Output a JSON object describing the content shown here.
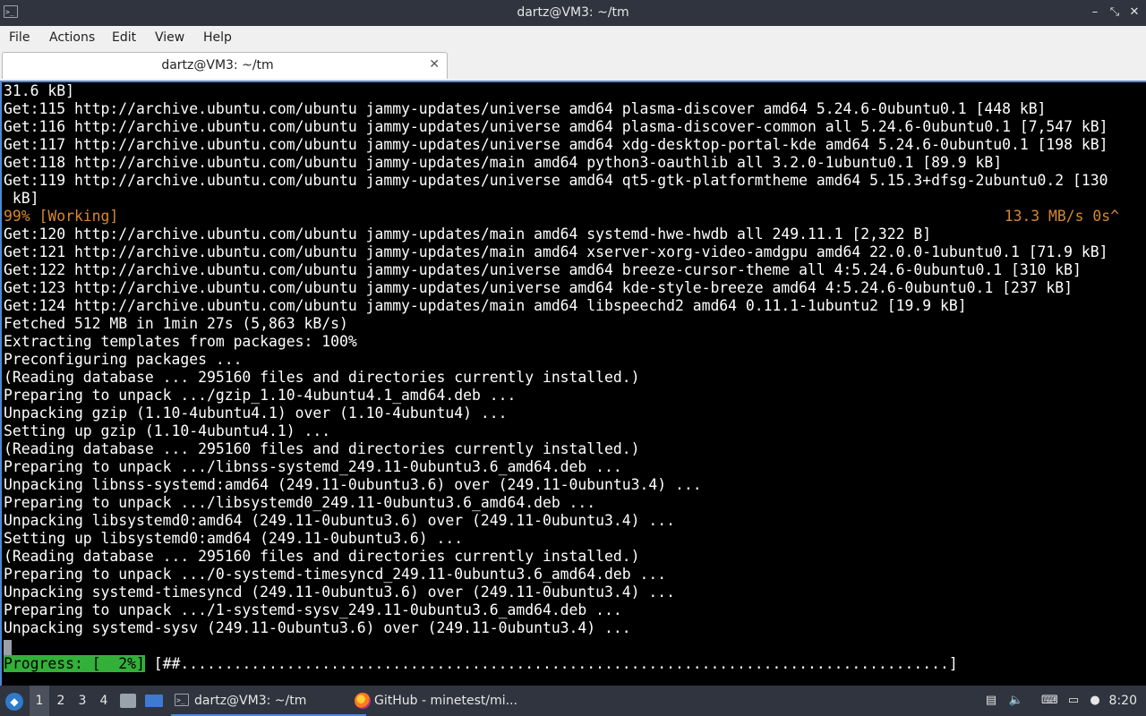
{
  "window": {
    "title": "dartz@VM3: ~/tm",
    "icon": "terminal-icon",
    "controls": {
      "minimize": "–",
      "maximize": "⤡",
      "close": "✕"
    }
  },
  "menu": [
    "File",
    "Actions",
    "Edit",
    "View",
    "Help"
  ],
  "tab": {
    "label": "dartz@VM3: ~/tm",
    "close": "✕"
  },
  "terminal": {
    "lines": [
      "31.6 kB]",
      "Get:115 http://archive.ubuntu.com/ubuntu jammy-updates/universe amd64 plasma-discover amd64 5.24.6-0ubuntu0.1 [448 kB]",
      "Get:116 http://archive.ubuntu.com/ubuntu jammy-updates/universe amd64 plasma-discover-common all 5.24.6-0ubuntu0.1 [7,547 kB]",
      "Get:117 http://archive.ubuntu.com/ubuntu jammy-updates/universe amd64 xdg-desktop-portal-kde amd64 5.24.6-0ubuntu0.1 [198 kB]",
      "Get:118 http://archive.ubuntu.com/ubuntu jammy-updates/main amd64 python3-oauthlib all 3.2.0-1ubuntu0.1 [89.9 kB]",
      "Get:119 http://archive.ubuntu.com/ubuntu jammy-updates/universe amd64 qt5-gtk-platformtheme amd64 5.15.3+dfsg-2ubuntu0.2 [130",
      " kB]"
    ],
    "status_left": "99% [Working]",
    "status_right": "13.3 MB/s 0s^",
    "lines2": [
      "Get:120 http://archive.ubuntu.com/ubuntu jammy-updates/main amd64 systemd-hwe-hwdb all 249.11.1 [2,322 B]",
      "Get:121 http://archive.ubuntu.com/ubuntu jammy-updates/main amd64 xserver-xorg-video-amdgpu amd64 22.0.0-1ubuntu0.1 [71.9 kB]",
      "Get:122 http://archive.ubuntu.com/ubuntu jammy-updates/universe amd64 breeze-cursor-theme all 4:5.24.6-0ubuntu0.1 [310 kB]",
      "Get:123 http://archive.ubuntu.com/ubuntu jammy-updates/universe amd64 kde-style-breeze amd64 4:5.24.6-0ubuntu0.1 [237 kB]",
      "Get:124 http://archive.ubuntu.com/ubuntu jammy-updates/main amd64 libspeechd2 amd64 0.11.1-1ubuntu2 [19.9 kB]",
      "Fetched 512 MB in 1min 27s (5,863 kB/s)",
      "Extracting templates from packages: 100%",
      "Preconfiguring packages ...",
      "(Reading database ... 295160 files and directories currently installed.)",
      "Preparing to unpack .../gzip_1.10-4ubuntu4.1_amd64.deb ...",
      "Unpacking gzip (1.10-4ubuntu4.1) over (1.10-4ubuntu4) ...",
      "Setting up gzip (1.10-4ubuntu4.1) ...",
      "(Reading database ... 295160 files and directories currently installed.)",
      "Preparing to unpack .../libnss-systemd_249.11-0ubuntu3.6_amd64.deb ...",
      "Unpacking libnss-systemd:amd64 (249.11-0ubuntu3.6) over (249.11-0ubuntu3.4) ...",
      "Preparing to unpack .../libsystemd0_249.11-0ubuntu3.6_amd64.deb ...",
      "Unpacking libsystemd0:amd64 (249.11-0ubuntu3.6) over (249.11-0ubuntu3.4) ...",
      "Setting up libsystemd0:amd64 (249.11-0ubuntu3.6) ...",
      "(Reading database ... 295160 files and directories currently installed.)",
      "Preparing to unpack .../0-systemd-timesyncd_249.11-0ubuntu3.6_amd64.deb ...",
      "Unpacking systemd-timesyncd (249.11-0ubuntu3.6) over (249.11-0ubuntu3.4) ...",
      "Preparing to unpack .../1-systemd-sysv_249.11-0ubuntu3.6_amd64.deb ...",
      "Unpacking systemd-sysv (249.11-0ubuntu3.6) over (249.11-0ubuntu3.4) ..."
    ],
    "progress_label": "Progress: [  2%]",
    "progress_percent": 2,
    "progress_bar": " [##.......................................................................................]"
  },
  "taskbar": {
    "start_icon": "lubuntu-start-icon",
    "workspaces": [
      "1",
      "2",
      "3",
      "4"
    ],
    "active_workspace": "1",
    "launchers": [
      "file-manager-icon",
      "show-desktop-icon"
    ],
    "tasks": [
      {
        "label": "dartz@VM3: ~/tm",
        "icon": "terminal-icon",
        "active": true
      },
      {
        "label": "GitHub - minetest/mi...",
        "icon": "firefox-icon",
        "active": false
      }
    ],
    "tray": [
      "battery-icon",
      "volume-icon",
      "keyboard-icon",
      "clipboard-icon",
      "notification-icon"
    ],
    "clock": "8:20"
  }
}
